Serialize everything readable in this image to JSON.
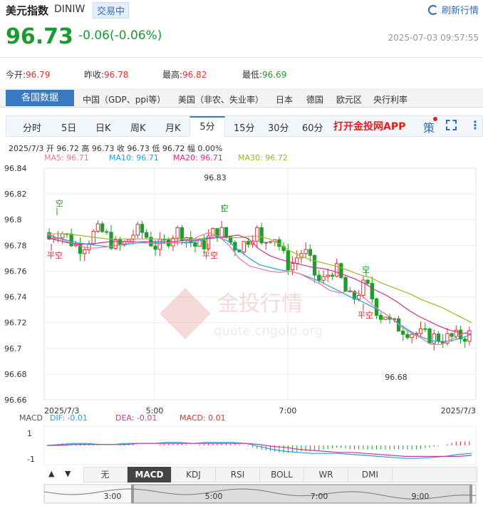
{
  "header": {
    "title": "美元指数",
    "code": "DINIW",
    "status": "交易中",
    "refresh": "刷新行情",
    "price": "96.73",
    "change": "-0.06(-0.06%)",
    "datetime": "2025-07-03 09:57:55"
  },
  "stats": [
    {
      "label": "今开:",
      "value": "96.79"
    },
    {
      "label": "昨收:",
      "value": "96.78"
    },
    {
      "label": "最高:",
      "value": "96.82"
    },
    {
      "label": "最低:",
      "value": "96.69"
    }
  ],
  "categories": {
    "active": "各国数据",
    "items": [
      "中国（GDP、ppi等）",
      "美国（非农、失业率）",
      "日本",
      "德国",
      "欧元区",
      "央行利率"
    ]
  },
  "tabs": {
    "items": [
      "分时",
      "5日",
      "日K",
      "周K",
      "月K",
      "5分",
      "15分",
      "30分",
      "60分"
    ],
    "active": "5分",
    "app_link": "打开金投网APP",
    "ce": "策"
  },
  "info": {
    "line": "2025/7/3  开 96.72  高 96.73  收 96.73  低 96.72  幅 0.00%",
    "ma5": "MA5: 96.71",
    "ma10": "MA10: 96.71",
    "ma20": "MA20: 96.71",
    "ma30": "MA30: 96.72"
  },
  "watermark": {
    "cn": "金投行情",
    "en": "quote.cngold.org"
  },
  "macd_labels": {
    "macd": "MACD",
    "dif": "DIF: -0.01",
    "dea": "DEA: -0.01",
    "val": "MACD: 0.01"
  },
  "indicators": {
    "items": [
      "无",
      "MACD",
      "KDJ",
      "RSI",
      "BOLL",
      "WR",
      "DMI"
    ],
    "active": "MACD",
    "up": "▲",
    "down": "▼"
  },
  "navigator": {
    "ticks": [
      "3:00",
      "5:00",
      "7:00",
      "9:00"
    ]
  },
  "chart_data": {
    "type": "candlestick",
    "ylim": [
      96.66,
      96.84
    ],
    "y_ticks": [
      "96.84",
      "96.82",
      "96.8",
      "96.78",
      "96.76",
      "96.74",
      "96.72",
      "96.7",
      "96.68",
      "96.66"
    ],
    "x_ticks": [
      "2025/7/3",
      "5:00",
      "7:00",
      "2025/7/3"
    ],
    "annotations": {
      "high": "96.83",
      "low": "96.68",
      "sell": "空",
      "buy": "平空"
    },
    "colors": {
      "up": "#d23535",
      "down": "#1e9e2a",
      "ma5": "#e87a9a",
      "ma10": "#19a8d8",
      "ma20": "#d62c8c",
      "ma30": "#a0b81e",
      "dif": "#26a0d8",
      "dea": "#c03ba8"
    },
    "ma_values": {
      "ma30": [
        96.789,
        96.789,
        96.789,
        96.788,
        96.787,
        96.786,
        96.785,
        96.785,
        96.785,
        96.785,
        96.785,
        96.785,
        96.785,
        96.785,
        96.785,
        96.785,
        96.786,
        96.786,
        96.786,
        96.786,
        96.787,
        96.787,
        96.785,
        96.781,
        96.776,
        96.772,
        96.769,
        96.767,
        96.765,
        96.763,
        96.76,
        96.757,
        96.755,
        96.751,
        96.748,
        96.745,
        96.742,
        96.738,
        96.735,
        96.732,
        96.728,
        96.724,
        96.72
      ],
      "ma20": [
        96.786,
        96.784,
        96.782,
        96.781,
        96.781,
        96.782,
        96.783,
        96.783,
        96.783,
        96.783,
        96.783,
        96.783,
        96.783,
        96.784,
        96.784,
        96.785,
        96.786,
        96.787,
        96.788,
        96.785,
        96.777,
        96.772,
        96.769,
        96.767,
        96.765,
        96.763,
        96.762,
        96.76,
        96.757,
        96.754,
        96.75,
        96.745,
        96.741,
        96.736,
        96.73,
        96.725,
        96.721,
        96.717,
        96.714,
        96.712,
        96.711
      ],
      "ma10": [
        96.788,
        96.786,
        96.784,
        96.782,
        96.781,
        96.78,
        96.779,
        96.78,
        96.781,
        96.782,
        96.782,
        96.782,
        96.782,
        96.782,
        96.782,
        96.784,
        96.786,
        96.786,
        96.783,
        96.776,
        96.77,
        96.765,
        96.763,
        96.761,
        96.76,
        96.758,
        96.755,
        96.752,
        96.748,
        96.744,
        96.74,
        96.737,
        96.733,
        96.729,
        96.724,
        96.718,
        96.713,
        96.709,
        96.706,
        96.705,
        96.706,
        96.708,
        96.711
      ],
      "ma5": [
        96.789,
        96.786,
        96.783,
        96.78,
        96.778,
        96.778,
        96.779,
        96.78,
        96.782,
        96.783,
        96.782,
        96.781,
        96.782,
        96.782,
        96.783,
        96.787,
        96.79,
        96.787,
        96.78,
        96.77,
        96.764,
        96.762,
        96.76,
        96.759,
        96.76,
        96.758,
        96.754,
        96.75,
        96.745,
        96.743,
        96.745,
        96.742,
        96.735,
        96.729,
        96.724,
        96.717,
        96.712,
        96.708,
        96.703,
        96.703,
        96.707,
        96.711,
        96.714
      ]
    },
    "macd": {
      "dif": [
        0.0,
        0.001,
        0.002,
        0.002,
        0.001,
        0.001,
        0.002,
        0.002,
        0.002,
        0.003,
        0.003,
        0.002,
        0.003,
        0.003,
        0.003,
        0.002,
        -0.001,
        -0.004,
        -0.006,
        -0.007,
        -0.008,
        -0.008,
        -0.008,
        -0.009,
        -0.01,
        -0.011,
        -0.012,
        -0.013,
        -0.013,
        -0.012,
        -0.011,
        -0.009,
        -0.008
      ],
      "dea": [
        0.0,
        0.0,
        0.001,
        0.001,
        0.001,
        0.001,
        0.001,
        0.002,
        0.002,
        0.002,
        0.002,
        0.002,
        0.002,
        0.002,
        0.002,
        0.002,
        0.001,
        -0.001,
        -0.002,
        -0.004,
        -0.005,
        -0.006,
        -0.007,
        -0.007,
        -0.008,
        -0.009,
        -0.01,
        -0.011,
        -0.011,
        -0.011,
        -0.011,
        -0.011,
        -0.01
      ]
    }
  }
}
